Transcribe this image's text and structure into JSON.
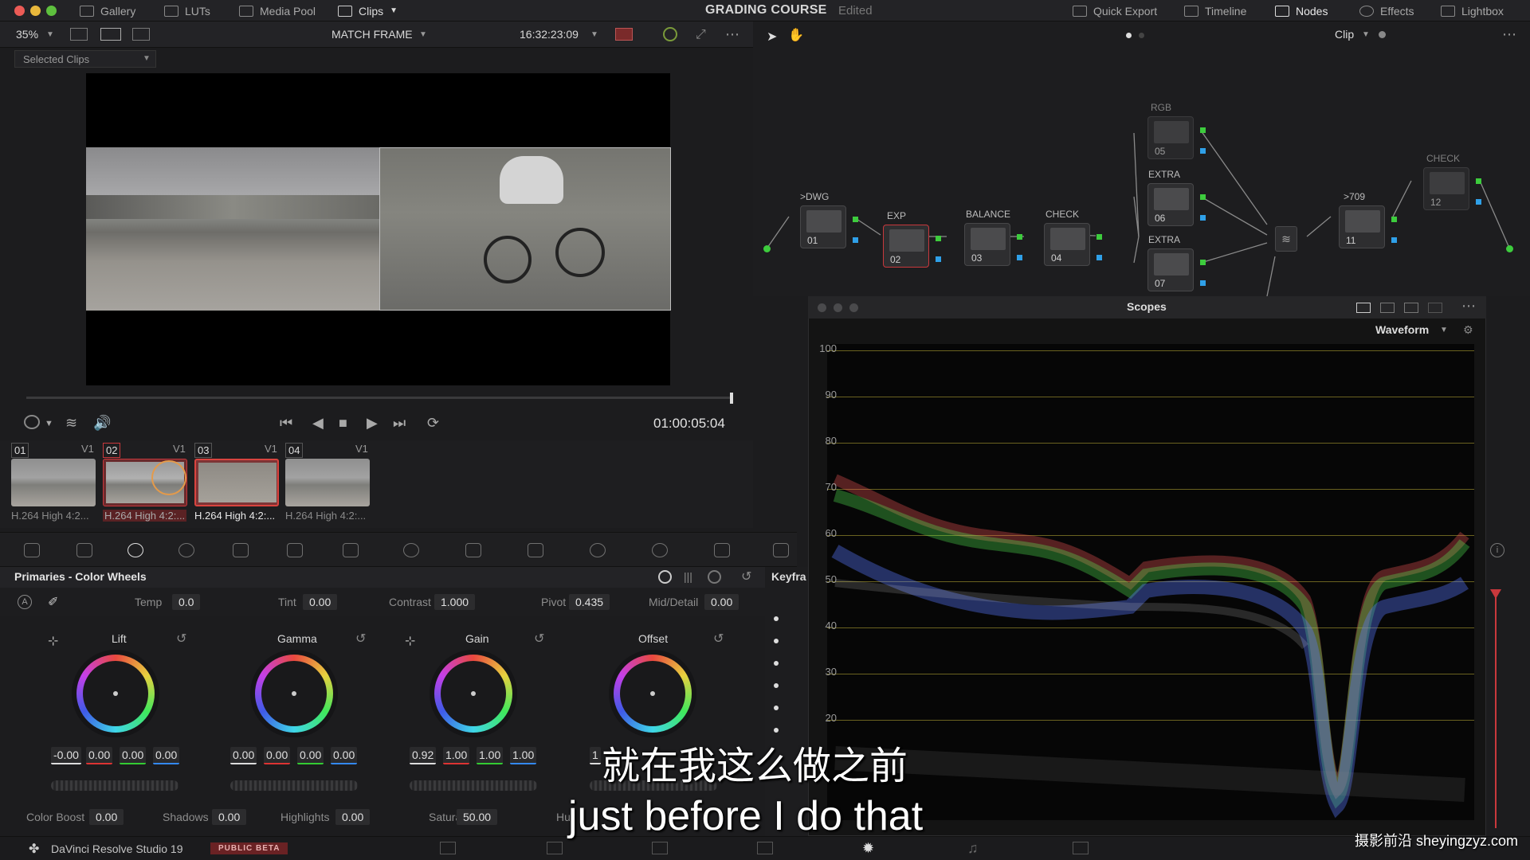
{
  "topbar": {
    "gallery": "Gallery",
    "luts": "LUTs",
    "media_pool": "Media Pool",
    "clips": "Clips",
    "title": "GRADING COURSE",
    "status": "Edited",
    "quick_export": "Quick Export",
    "timeline": "Timeline",
    "nodes": "Nodes",
    "effects": "Effects",
    "lightbox": "Lightbox"
  },
  "viewer_toolbar": {
    "zoom": "35%",
    "mode": "MATCH FRAME",
    "timecode": "16:32:23:09",
    "selected_clips": "Selected Clips"
  },
  "node_toolbar": {
    "clip_mode": "Clip"
  },
  "playback": {
    "timecode": "01:00:05:04"
  },
  "clips": [
    {
      "num": "01",
      "track": "V1",
      "name": "H.264 High 4:2..."
    },
    {
      "num": "02",
      "track": "V1",
      "name": "H.264 High 4:2:..."
    },
    {
      "num": "03",
      "track": "V1",
      "name": "H.264 High 4:2:..."
    },
    {
      "num": "04",
      "track": "V1",
      "name": "H.264 High 4:2:..."
    }
  ],
  "primaries": {
    "title": "Primaries - Color Wheels",
    "keyframes": "Keyfra",
    "temp_label": "Temp",
    "temp": "0.0",
    "tint_label": "Tint",
    "tint": "0.00",
    "contrast_label": "Contrast",
    "contrast": "1.000",
    "pivot_label": "Pivot",
    "pivot": "0.435",
    "middetail_label": "Mid/Detail",
    "middetail": "0.00",
    "wheels": [
      {
        "name": "Lift",
        "v": [
          "-0.00",
          "0.00",
          "0.00",
          "0.00"
        ]
      },
      {
        "name": "Gamma",
        "v": [
          "0.00",
          "0.00",
          "0.00",
          "0.00"
        ]
      },
      {
        "name": "Gain",
        "v": [
          "0.92",
          "1.00",
          "1.00",
          "1.00"
        ]
      },
      {
        "name": "Offset",
        "v": [
          "1",
          "",
          "",
          ""
        ]
      }
    ],
    "colorboost_label": "Color Boost",
    "colorboost": "0.00",
    "shadows_label": "Shadows",
    "shadows": "0.00",
    "highlights_label": "Highlights",
    "highlights": "0.00",
    "saturation_label": "Saturation",
    "saturation": "50.00",
    "hue_label": "Hu"
  },
  "nodes": {
    "labels": [
      ">DWG",
      "EXP",
      "BALANCE",
      "CHECK",
      "RGB",
      "EXTRA",
      "EXTRA",
      ">709",
      "CHECK"
    ],
    "numbers": [
      "01",
      "02",
      "03",
      "04",
      "05",
      "06",
      "07",
      "11",
      "12"
    ]
  },
  "scopes": {
    "title": "Scopes",
    "type": "Waveform",
    "scale": [
      "100",
      "90",
      "80",
      "70",
      "60",
      "50",
      "40",
      "30",
      "20"
    ]
  },
  "bottombar": {
    "app": "DaVinci Resolve Studio 19",
    "badge": "PUBLIC BETA"
  },
  "subtitles": {
    "zh": "就在我这么做之前",
    "en": "just before I do that"
  },
  "watermark": "摄影前沿 sheyingzyz.com",
  "colors": {
    "accent_red": "#c8383c",
    "node_green": "#3dcc3d",
    "node_blue": "#2fa0e8",
    "badge_red": "#b33a3a"
  }
}
